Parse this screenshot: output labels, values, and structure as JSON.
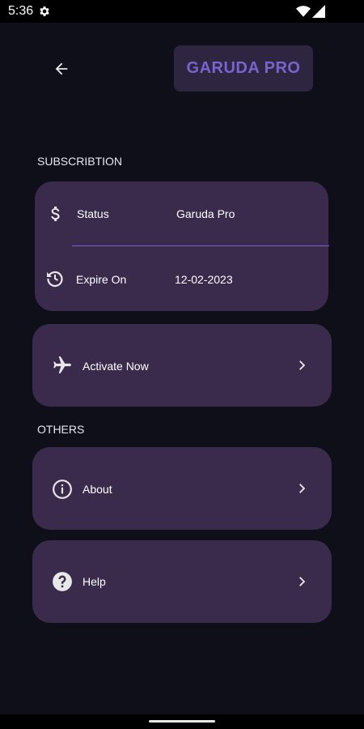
{
  "status_bar": {
    "time": "5:36"
  },
  "header": {
    "badge_label": "GARUDA PRO"
  },
  "subscription": {
    "section_label": "SUBSCRIBTION",
    "status_label": "Status",
    "status_value": "Garuda Pro",
    "expire_label": "Expire On",
    "expire_value": "12-02-2023"
  },
  "activate": {
    "label": "Activate Now"
  },
  "others": {
    "section_label": "OTHERS",
    "about_label": "About",
    "help_label": "Help"
  },
  "colors": {
    "background": "#0f0f1a",
    "card": "#3a2b4d",
    "accent": "#7a63cf",
    "badge_bg": "#2e2640"
  },
  "icons": [
    "gear-icon",
    "wifi-icon",
    "signal-icon",
    "back-arrow-icon",
    "dollar-icon",
    "history-icon",
    "airplane-icon",
    "info-icon",
    "help-icon",
    "chevron-right-icon"
  ]
}
